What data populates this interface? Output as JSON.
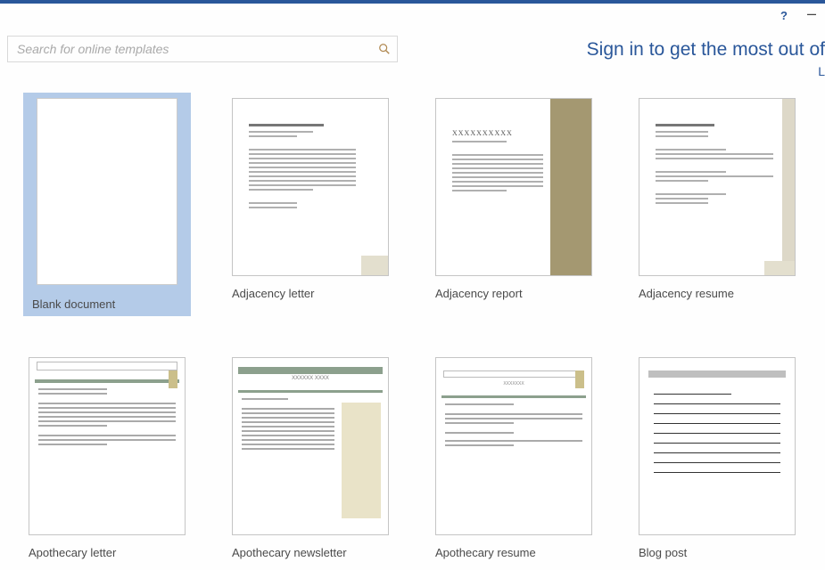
{
  "colors": {
    "accent": "#2a579a"
  },
  "window": {
    "help_label": "?",
    "minimize_label": "–"
  },
  "search": {
    "placeholder": "Search for online templates",
    "button_name": "search"
  },
  "signin": {
    "line": "Sign in to get the most out of",
    "sub": "L"
  },
  "templates": [
    {
      "id": "blank-document",
      "label": "Blank document",
      "selected": true,
      "style": "blank"
    },
    {
      "id": "adjacency-letter",
      "label": "Adjacency letter",
      "selected": false,
      "style": "adj-letter"
    },
    {
      "id": "adjacency-report",
      "label": "Adjacency report",
      "selected": false,
      "style": "adj-report"
    },
    {
      "id": "adjacency-resume",
      "label": "Adjacency resume",
      "selected": false,
      "style": "adj-resume"
    },
    {
      "id": "apothecary-letter",
      "label": "Apothecary letter",
      "selected": false,
      "style": "apoth-letter"
    },
    {
      "id": "apothecary-newsletter",
      "label": "Apothecary newsletter",
      "selected": false,
      "style": "apoth-news"
    },
    {
      "id": "apothecary-resume",
      "label": "Apothecary resume",
      "selected": false,
      "style": "apoth-resume"
    },
    {
      "id": "blog-post",
      "label": "Blog post",
      "selected": false,
      "style": "blog"
    }
  ]
}
